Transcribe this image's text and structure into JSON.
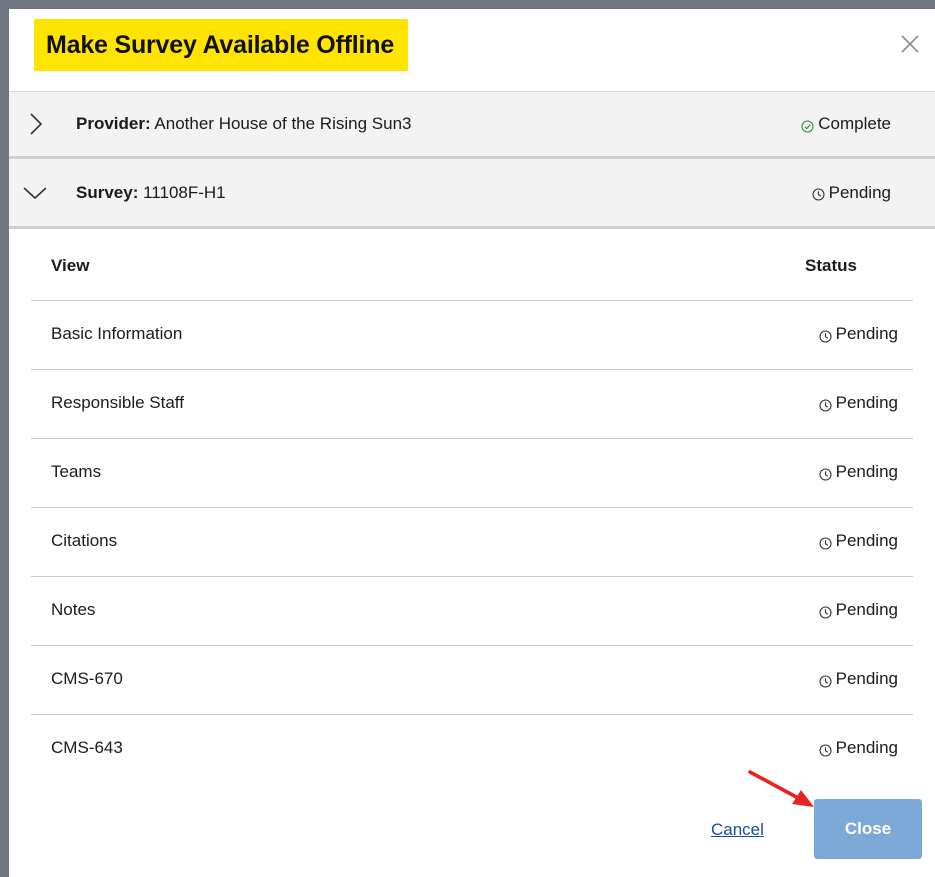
{
  "dialog": {
    "title": "Make Survey Available Offline",
    "title_highlight_color": "#ffe400",
    "close_icon": "close-icon"
  },
  "provider": {
    "label_key": "Provider:",
    "label_value": " Another House of the Rising Sun3",
    "status": "Complete",
    "status_icon": "check-circle-icon",
    "expanded": false
  },
  "survey": {
    "label_key": "Survey:",
    "label_value": " 11108F-H1",
    "status": "Pending",
    "status_icon": "clock-icon",
    "expanded": true
  },
  "table": {
    "headers": {
      "view": "View",
      "status": "Status"
    },
    "rows": [
      {
        "view": "Basic Information",
        "status": "Pending"
      },
      {
        "view": "Responsible Staff",
        "status": "Pending"
      },
      {
        "view": "Teams",
        "status": "Pending"
      },
      {
        "view": "Citations",
        "status": "Pending"
      },
      {
        "view": "Notes",
        "status": "Pending"
      },
      {
        "view": "CMS-670",
        "status": "Pending"
      },
      {
        "view": "CMS-643",
        "status": "Pending"
      }
    ]
  },
  "footer": {
    "cancel_label": "Cancel",
    "close_label": "Close",
    "close_button_color": "#7ca9d8",
    "annotation": "red-arrow-pointing-to-close"
  }
}
